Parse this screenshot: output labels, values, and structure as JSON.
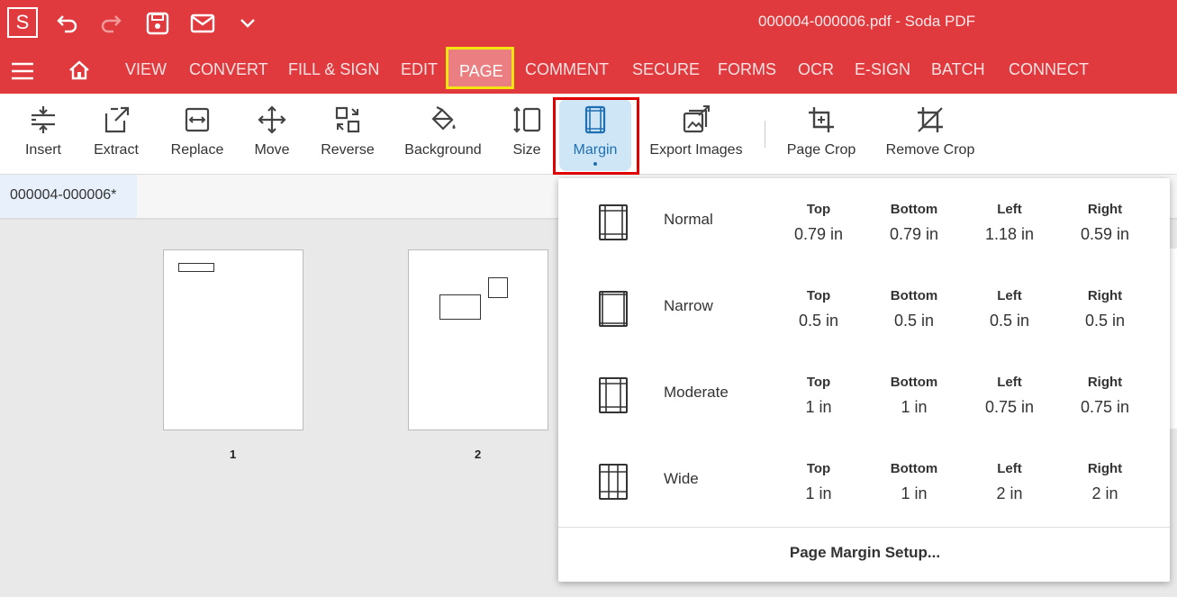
{
  "app": {
    "logo_letter": "S",
    "document_title": "000004-000006.pdf  -  Soda PDF"
  },
  "menu": {
    "items": [
      "VIEW",
      "CONVERT",
      "FILL & SIGN",
      "EDIT",
      "PAGE",
      "COMMENT",
      "SECURE",
      "FORMS",
      "OCR",
      "E-SIGN",
      "BATCH",
      "CONNECT"
    ],
    "active": "PAGE"
  },
  "ribbon": {
    "insert": "Insert",
    "extract": "Extract",
    "replace": "Replace",
    "move": "Move",
    "reverse": "Reverse",
    "background": "Background",
    "size": "Size",
    "margin": "Margin",
    "export_images": "Export Images",
    "page_crop": "Page Crop",
    "remove_crop": "Remove Crop"
  },
  "doc_tab": {
    "label": "000004-000006*"
  },
  "thumbnails": [
    {
      "number": "1"
    },
    {
      "number": "2"
    }
  ],
  "margin_dropdown": {
    "headers": {
      "top": "Top",
      "bottom": "Bottom",
      "left": "Left",
      "right": "Right"
    },
    "options": [
      {
        "name": "Normal",
        "top": "0.79 in",
        "bottom": "0.79 in",
        "left": "1.18 in",
        "right": "0.59 in"
      },
      {
        "name": "Narrow",
        "top": "0.5 in",
        "bottom": "0.5 in",
        "left": "0.5 in",
        "right": "0.5 in"
      },
      {
        "name": "Moderate",
        "top": "1 in",
        "bottom": "1 in",
        "left": "0.75 in",
        "right": "0.75 in"
      },
      {
        "name": "Wide",
        "top": "1 in",
        "bottom": "1 in",
        "left": "2 in",
        "right": "2 in"
      }
    ],
    "setup_label": "Page Margin Setup..."
  },
  "colors": {
    "brand_red": "#e03a3e",
    "highlight_yellow": "#f3e60f",
    "selected_blue": "#cfe6f7",
    "annotation_red": "#e10000"
  }
}
